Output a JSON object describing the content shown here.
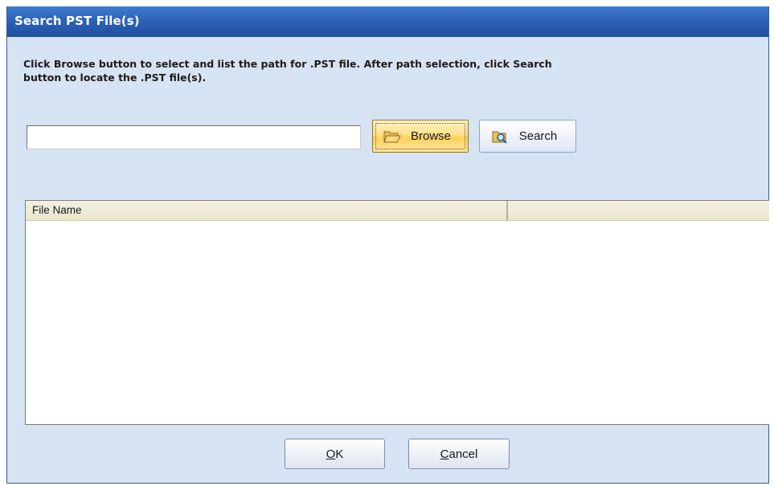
{
  "dialog": {
    "title": "Search PST File(s)",
    "instructions": "Click Browse button to select and list the path for .PST file. After path selection, click Search button to locate the .PST file(s)."
  },
  "path_input": {
    "value": "",
    "placeholder": ""
  },
  "buttons": {
    "browse": {
      "label": "Browse",
      "icon": "folder-open-icon"
    },
    "search": {
      "label": "Search",
      "icon": "magnifier-icon"
    },
    "ok": {
      "mnemonic": "O",
      "rest": "K"
    },
    "cancel": {
      "mnemonic": "C",
      "rest": "ancel"
    }
  },
  "file_list": {
    "columns": [
      "File Name",
      ""
    ],
    "rows": []
  },
  "colors": {
    "title_bar": "#2d63b8",
    "dialog_background": "#d6e3f3",
    "browse_highlight": "#ffd060"
  }
}
